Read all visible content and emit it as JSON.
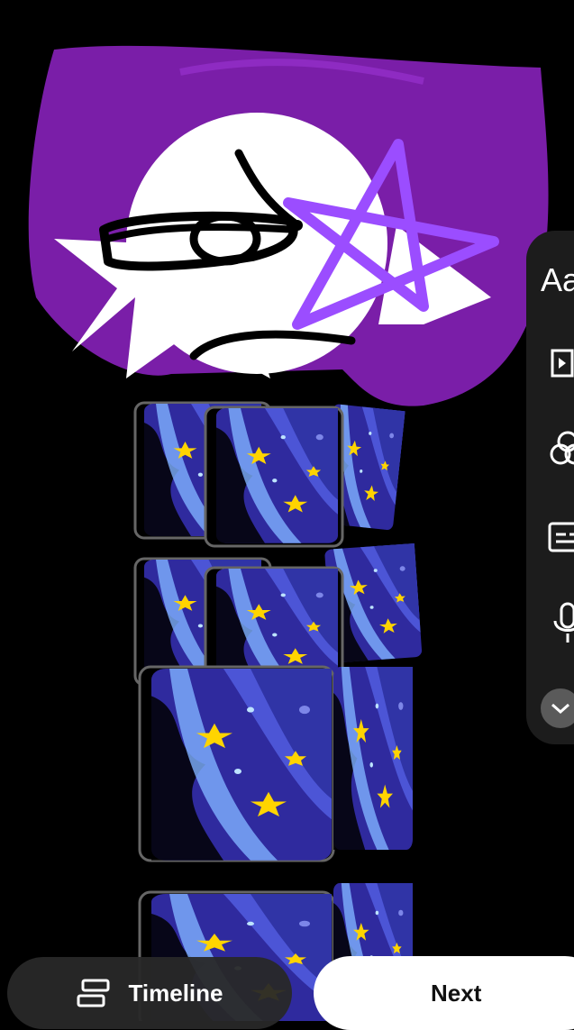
{
  "side_rail": {
    "text_tool_label": "Aa",
    "tools": [
      {
        "icon": "clip-split-icon"
      },
      {
        "icon": "filters-icon"
      },
      {
        "icon": "captions-icon"
      },
      {
        "icon": "microphone-icon"
      }
    ],
    "more_icon": "chevron-down-icon"
  },
  "bottom_bar": {
    "timeline_label": "Timeline",
    "next_label": "Next"
  },
  "colors": {
    "background": "#000000",
    "hair_purple": "#7a1ea8",
    "star_outline": "#9b4dff",
    "card_blue": "#3d3ab0"
  }
}
